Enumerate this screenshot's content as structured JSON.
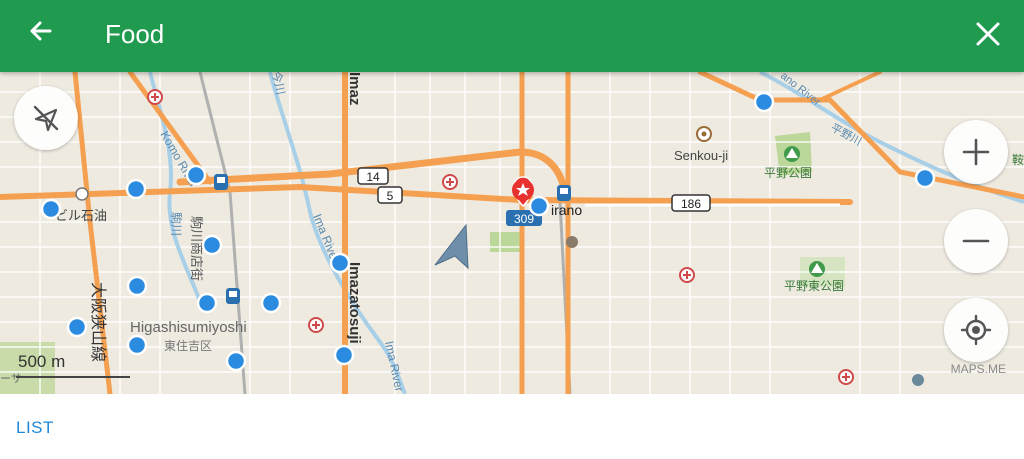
{
  "toolbar": {
    "title": "Food",
    "back_icon": "arrow-left-icon",
    "close_icon": "close-icon",
    "color": "#1f9a4f"
  },
  "map": {
    "labels": {
      "komo_river": "Komo River",
      "komagawa_jp": "駒川",
      "komagawa_shotengai": "駒川商店街",
      "imazato_top": "Imaz",
      "imazatosuji": "Imazatosuji",
      "ima_river": "Ima River",
      "ima_river_bottom": "Ima River",
      "ima_river_jp": "今川",
      "higashisumiyoshi": "Higashisumiyoshi",
      "higashisumiyoshi_jp": "東住吉区",
      "osaka_sayama": "大阪狭山線",
      "mobil": "ービル石油",
      "senkouji": "Senkou-ji",
      "hirano_park": "平野公園",
      "hirano_east_park": "平野東公園",
      "hirano": "irano",
      "hirano_river": "平野川",
      "iwa_river": "ano River",
      "edge_char": "鞍",
      "edge_char_left": "ーサ"
    },
    "route_shields": {
      "r14": "14",
      "r5": "5",
      "r186": "186",
      "r309": "309"
    },
    "marker_color": "#2a8be0",
    "selected_marker_color": "#e8322f",
    "road_color": "#f5a050"
  },
  "controls": {
    "zoom_in_icon": "plus-icon",
    "zoom_out_icon": "minus-icon",
    "location_icon": "my-location-icon",
    "gps_off_icon": "location-disabled-icon"
  },
  "scale": {
    "label": "500 m"
  },
  "attribution": "MAPS.ME",
  "bottom": {
    "list_label": "LIST",
    "list_color": "#1e88d8"
  }
}
